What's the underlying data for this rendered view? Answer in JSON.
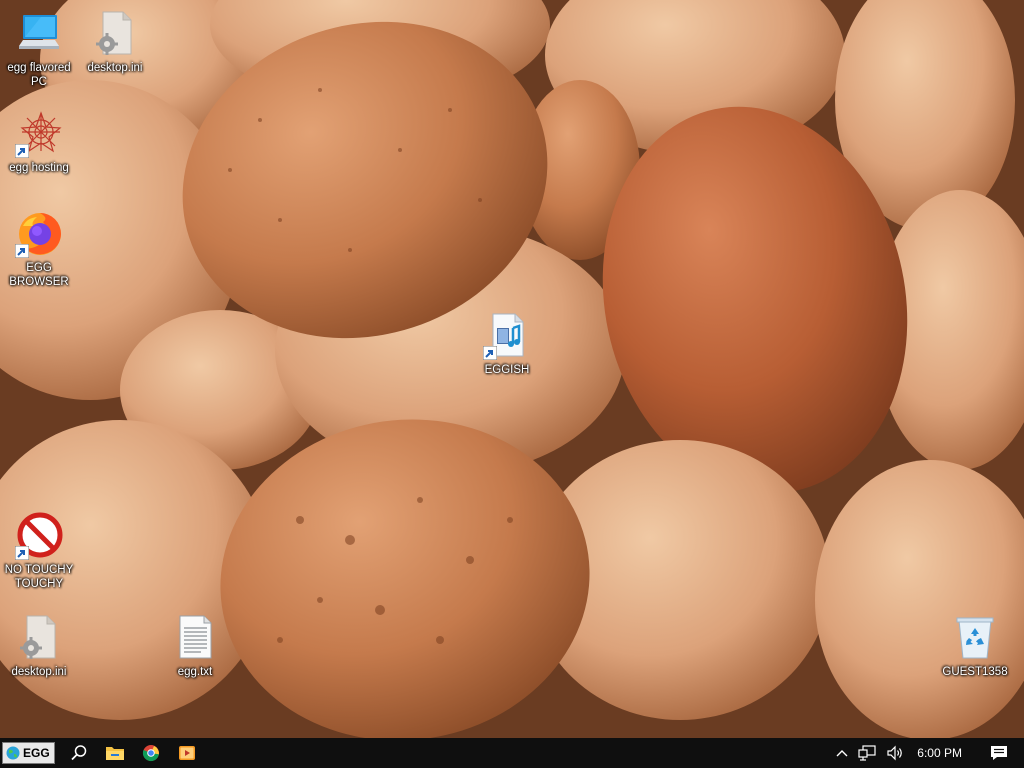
{
  "desktop": {
    "icons": [
      {
        "label": "egg flavored PC",
        "icon": "computer-icon"
      },
      {
        "label": "desktop.ini",
        "icon": "settings-file-icon"
      },
      {
        "label": "egg hosting",
        "icon": "egg-hosting-icon"
      },
      {
        "label": "EGG BROWSER",
        "icon": "firefox-icon"
      },
      {
        "label": "EGGISH",
        "icon": "media-file-icon"
      },
      {
        "label": "NO TOUCHY TOUCHY",
        "icon": "prohibited-icon"
      },
      {
        "label": "desktop.ini",
        "icon": "settings-file-icon"
      },
      {
        "label": "egg.txt",
        "icon": "text-file-icon"
      },
      {
        "label": "GUEST1358",
        "icon": "recycle-bin-icon"
      }
    ]
  },
  "taskbar": {
    "start_label": "EGG",
    "pinned": [
      "search-icon",
      "file-explorer-icon",
      "chrome-icon",
      "media-player-icon"
    ],
    "tray": {
      "icons": [
        "chevron-up-icon",
        "network-icon",
        "volume-icon"
      ],
      "clock": "6:00 PM",
      "notification_icon": "action-center-icon"
    }
  },
  "colors": {
    "taskbar": "#0f0f0f",
    "wallpaper_base": "#c98e66"
  }
}
